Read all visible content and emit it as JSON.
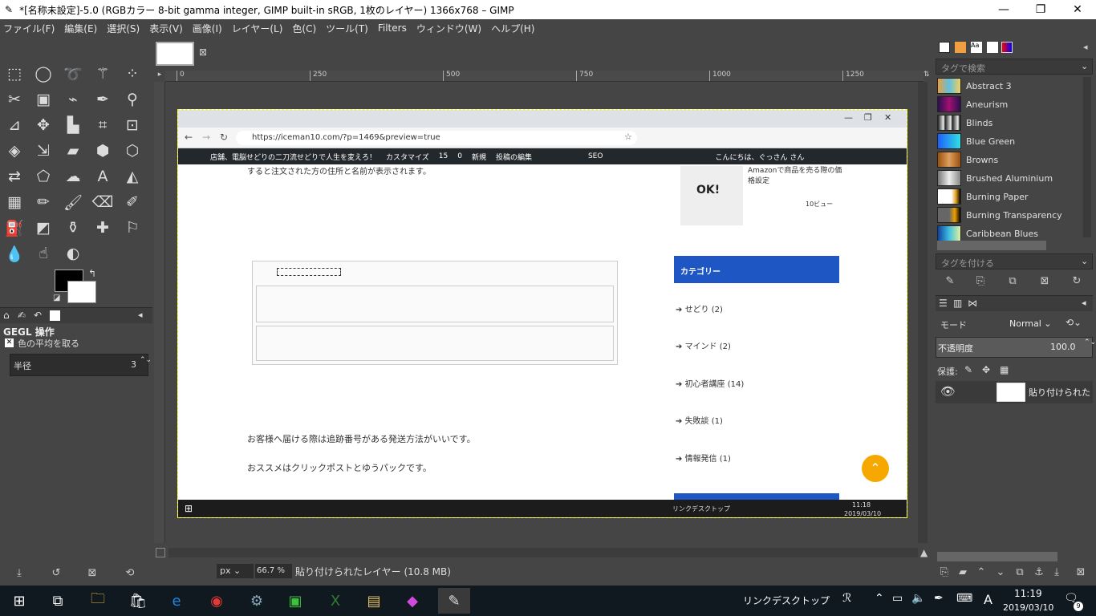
{
  "window": {
    "title": "*[名称未設定]-5.0 (RGBカラー 8-bit gamma integer, GIMP built-in sRGB, 1枚のレイヤー) 1366x768 – GIMP"
  },
  "menu": [
    "ファイル(F)",
    "編集(E)",
    "選択(S)",
    "表示(V)",
    "画像(I)",
    "レイヤー(L)",
    "色(C)",
    "ツール(T)",
    "Filters",
    "ウィンドウ(W)",
    "ヘルプ(H)"
  ],
  "rulers": {
    "top": [
      "0",
      "250",
      "500",
      "750",
      "1000",
      "1250"
    ]
  },
  "toolbox": {
    "tool_options_title": "GEGL 操作",
    "option_checkbox": "色の平均を取る",
    "radius_label": "半径",
    "radius_value": "3"
  },
  "browser": {
    "url": "https://iceman10.com/?p=1469&preview=true",
    "wpbar": {
      "site": "店舗、電脳せどりの二刀流せどりで人生を変えろ！",
      "customize": "カスタマイズ",
      "count": "15",
      "comments": "0",
      "new": "新規",
      "edit": "投稿の編集",
      "seo": "SEO",
      "greeting": "こんにちは、ぐっさん さん"
    },
    "post": {
      "line1": "すると注文された方の住所と名前が表示されます。",
      "line2": "お客様へ届ける際は追跡番号がある発送方法がいいです。",
      "line3": "おススメはクリックポストとゆうパックです。"
    },
    "sidebar": {
      "popular_text": "Amazonで商品を売る際の価格設定",
      "views": "10ビュー",
      "category_title": "カテゴリー",
      "categories": [
        "せどり (2)",
        "マインド (2)",
        "初心者講座 (14)",
        "失敗談 (1)",
        "情報発信 (1)"
      ]
    },
    "inner_taskbar": {
      "link": "リンク",
      "desktop": "デスクトップ",
      "time": "11:18",
      "date": "2019/03/10"
    }
  },
  "status": {
    "unit": "px",
    "zoom": "66.7 %",
    "text": "貼り付けられたレイヤー (10.8 MB)"
  },
  "right": {
    "tag_search_placeholder": "タグで検索",
    "gradients": [
      "Abstract 3",
      "Aneurism",
      "Blinds",
      "Blue Green",
      "Browns",
      "Brushed Aluminium",
      "Burning Paper",
      "Burning Transparency",
      "Caribbean Blues"
    ],
    "tag_assign_placeholder": "タグを付ける",
    "mode_label": "モード",
    "mode_value": "Normal",
    "opacity_label": "不透明度",
    "opacity_value": "100.0",
    "lock_label": "保護:",
    "layer_name": "貼り付けられた"
  },
  "taskbar": {
    "link": "リンク",
    "desktop": "デスクトップ",
    "ime": "A",
    "time": "11:19",
    "date": "2019/03/10",
    "notif": "9"
  }
}
